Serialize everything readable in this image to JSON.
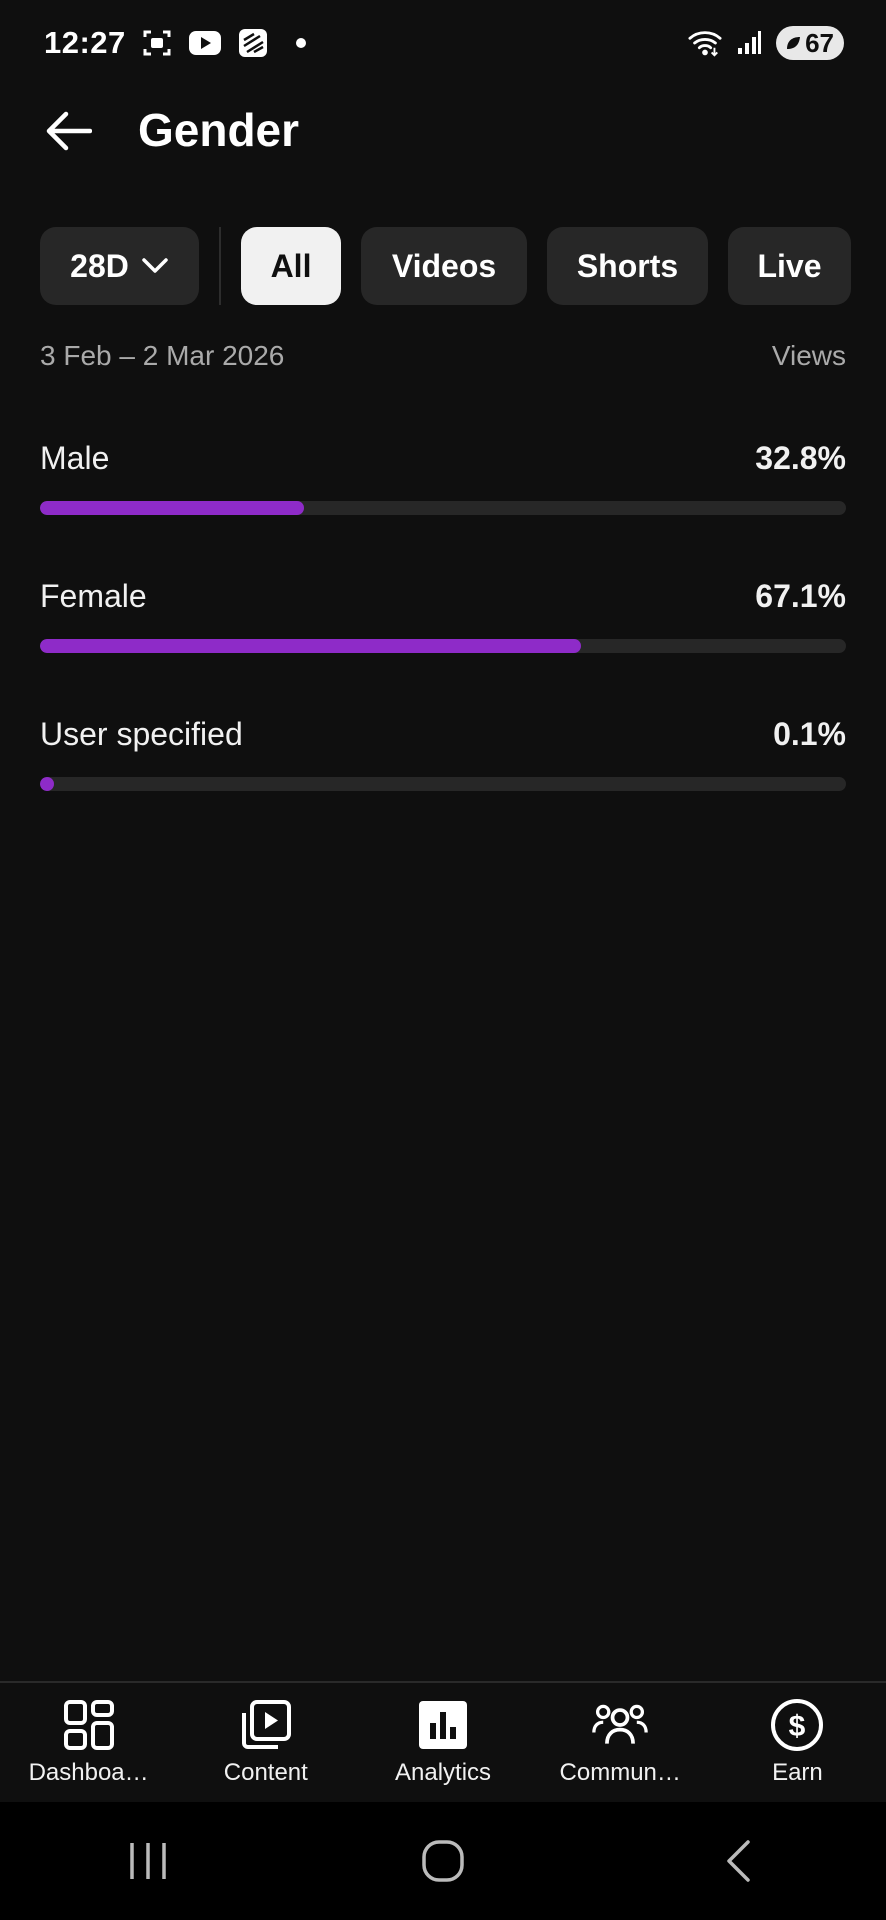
{
  "status_bar": {
    "time": "12:27",
    "battery": "67",
    "icons": [
      "screenshot-icon",
      "youtube-icon",
      "app-icon",
      "notification-dot-icon",
      "wifi-icon",
      "signal-icon",
      "battery-icon"
    ]
  },
  "header": {
    "title": "Gender",
    "back_icon": "back-arrow-icon"
  },
  "filters": {
    "period": "28D",
    "chips": [
      "All",
      "Videos",
      "Shorts",
      "Live"
    ],
    "selected": "All"
  },
  "range": {
    "dates": "3 Feb – 2 Mar 2026",
    "metric": "Views"
  },
  "genders": [
    {
      "label": "Male",
      "value": "32.8%",
      "fraction": 0.328
    },
    {
      "label": "Female",
      "value": "67.1%",
      "fraction": 0.671
    },
    {
      "label": "User specified",
      "value": "0.1%",
      "fraction": 0.001
    }
  ],
  "colors": {
    "bar_fill": "#8e2bc8",
    "bar_track": "#272727",
    "background": "#0f0f0f"
  },
  "bottom_nav": [
    {
      "label": "Dashboa…",
      "icon": "dashboard-icon"
    },
    {
      "label": "Content",
      "icon": "content-icon"
    },
    {
      "label": "Analytics",
      "icon": "analytics-icon"
    },
    {
      "label": "Commun…",
      "icon": "community-icon"
    },
    {
      "label": "Earn",
      "icon": "earn-icon"
    }
  ],
  "system_nav": [
    "recents-icon",
    "home-icon",
    "back-icon"
  ]
}
